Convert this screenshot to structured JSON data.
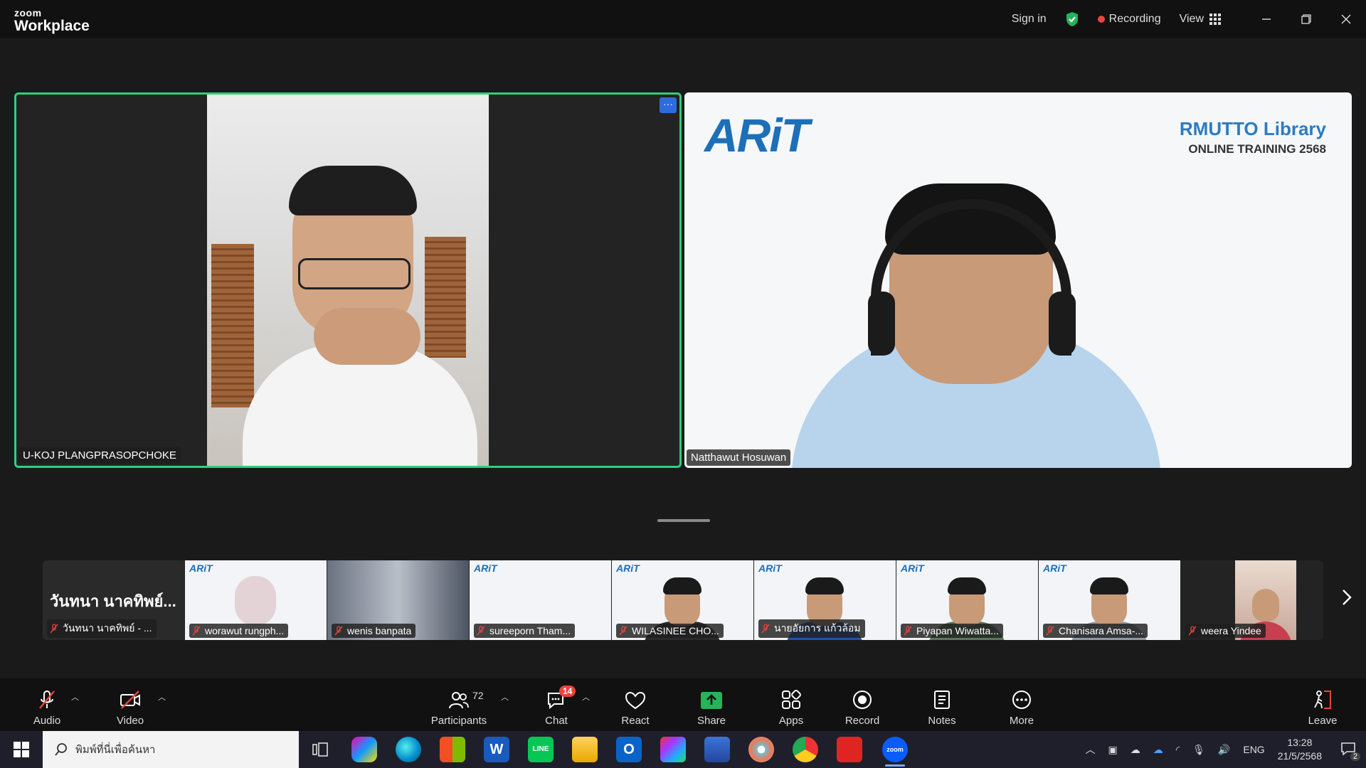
{
  "titlebar": {
    "logo_top": "zoom",
    "logo_bottom": "Workplace",
    "sign_in": "Sign in",
    "recording": "Recording",
    "view": "View"
  },
  "speakers": {
    "left_name": "U-KOJ PLANGPRASOPCHOKE",
    "right_name": "Natthawut Hosuwan",
    "slide_logo": "ARiT",
    "slide_title": "RMUTTO Library",
    "slide_subtitle": "ONLINE TRAINING 2568"
  },
  "filmstrip": {
    "first_big": "วันทนา นาคทิพย์...",
    "participants": [
      "วันทนา นาคทิพย์ - ...",
      "worawut rungph...",
      "wenis banpata",
      "sureeporn  Tham...",
      "WILASINEE CHO...",
      "นายอัยการ แก้วล้อม",
      "Piyapan Wiwatta...",
      "Chanisara Amsa-...",
      "weera Yindee"
    ]
  },
  "toolbar": {
    "audio": "Audio",
    "video": "Video",
    "participants": "Participants",
    "participants_count": "72",
    "chat": "Chat",
    "chat_badge": "14",
    "react": "React",
    "share": "Share",
    "apps": "Apps",
    "record": "Record",
    "notes": "Notes",
    "more": "More",
    "leave": "Leave"
  },
  "taskbar": {
    "search_placeholder": "พิมพ์ที่นี่เพื่อค้นหา",
    "lang": "ENG",
    "time": "13:28",
    "date": "21/5/2568",
    "notif_count": "2"
  },
  "colors": {
    "active_speaker_border": "#2fd07c",
    "record_dot": "#e8453c",
    "share_green": "#27b35a"
  }
}
